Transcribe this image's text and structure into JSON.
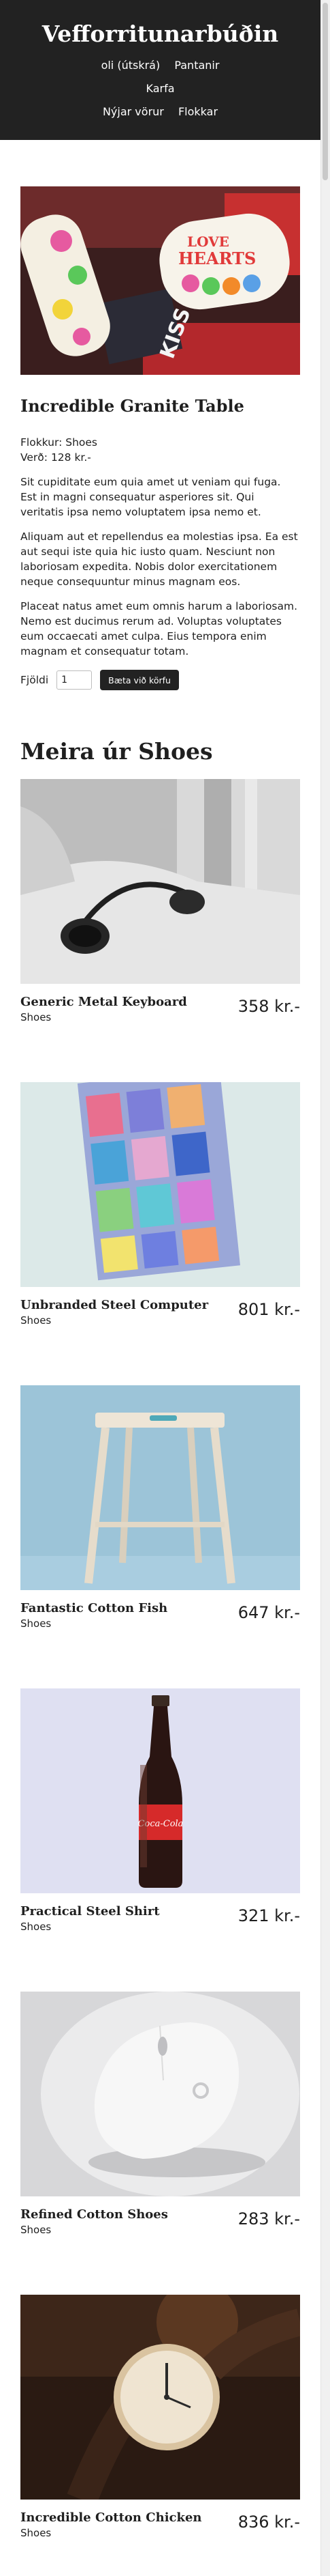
{
  "site": {
    "title": "Vefforritunarbúðin",
    "nav_row1": [
      "oli (útskrá)",
      "Pantanir"
    ],
    "nav_row2": [
      "Karfa"
    ],
    "nav_row3": [
      "Nýjar vörur",
      "Flokkar"
    ]
  },
  "product": {
    "image_alt": "Love Hearts sweets",
    "image_text": [
      "LOVE",
      "HEARTS",
      "KISS"
    ],
    "title": "Incredible Granite Table",
    "category_line": "Flokkur: Shoes",
    "price_line": "Verð: 128 kr.-",
    "paragraphs": [
      "Sit cupiditate eum quia amet ut veniam qui fuga. Est in magni consequatur asperiores sit. Qui veritatis ipsa nemo voluptatem ipsa nemo et.",
      "Aliquam aut et repellendus ea molestias ipsa. Ea est aut sequi iste quia hic iusto quam. Nesciunt non laboriosam expedita. Nobis dolor exercitationem neque consequuntur minus magnam eos.",
      "Placeat natus amet eum omnis harum a laboriosam. Nemo est ducimus rerum ad. Voluptas voluptates eum occaecati amet culpa. Eius tempora enim magnam et consequatur totam."
    ],
    "quantity_label": "Fjöldi",
    "quantity_value": "1",
    "add_to_cart_label": "Bæta við körfu"
  },
  "related": {
    "title": "Meira úr Shoes",
    "items": [
      {
        "name": "Generic Metal Keyboard",
        "category": "Shoes",
        "price": "358 kr.-",
        "image": "headphones-photo"
      },
      {
        "name": "Unbranded Steel Computer",
        "category": "Shoes",
        "price": "801 kr.-",
        "image": "colorful-abstract-photo"
      },
      {
        "name": "Fantastic Cotton Fish",
        "category": "Shoes",
        "price": "647 kr.-",
        "image": "wooden-stool-photo"
      },
      {
        "name": "Practical Steel Shirt",
        "category": "Shoes",
        "price": "321 kr.-",
        "image": "cola-bottle-photo",
        "image_text": "Coca-Cola"
      },
      {
        "name": "Refined Cotton Shoes",
        "category": "Shoes",
        "price": "283 kr.-",
        "image": "mouse-photo"
      },
      {
        "name": "Incredible Cotton Chicken",
        "category": "Shoes",
        "price": "836 kr.-",
        "image": "watch-photo"
      }
    ]
  },
  "colors": {
    "header_bg": "#222222",
    "button_bg": "#222222",
    "text": "#1f1f1f"
  }
}
